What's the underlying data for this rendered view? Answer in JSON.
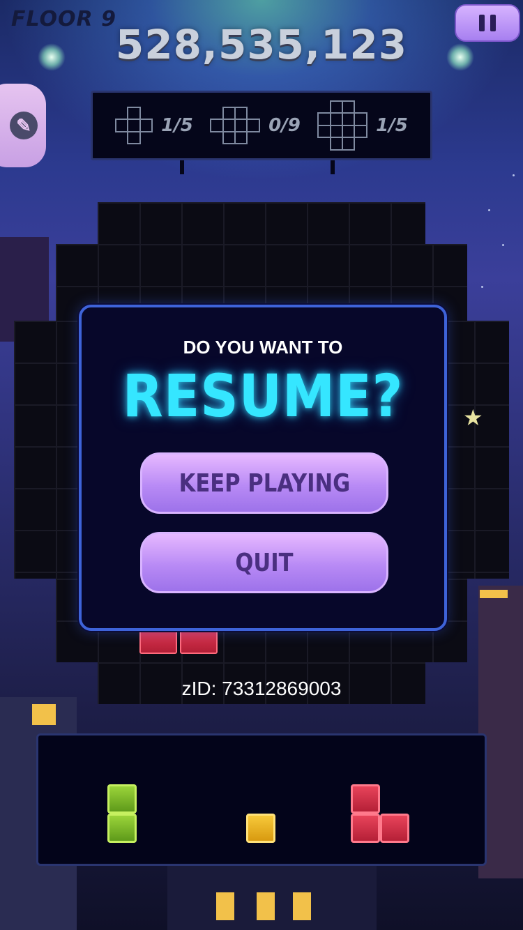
{
  "hud": {
    "floor_label": "FLOOR 9",
    "score": "528,535,123",
    "pause_icon": "pause-icon",
    "settings_icon": "wrench-icon"
  },
  "goals": [
    {
      "shape": "plus-shape",
      "count": "1/5"
    },
    {
      "shape": "cross-shape",
      "count": "0/9"
    },
    {
      "shape": "large-cross-shape",
      "count": "1/5"
    }
  ],
  "dialog": {
    "prompt": "DO YOU WANT TO",
    "title": "RESUME?",
    "keep_playing_label": "KEEP PLAYING",
    "quit_label": "QUIT"
  },
  "zid_text": "zID: 73312869003",
  "tray": {
    "pieces": [
      {
        "color": "green",
        "name": "vertical-2-piece"
      },
      {
        "color": "yellow",
        "name": "single-piece"
      },
      {
        "color": "red",
        "name": "l-piece"
      }
    ]
  },
  "colors": {
    "accent_cyan": "#35e6ff",
    "button_purple": "#b88af5",
    "dialog_border": "#3e63d8"
  }
}
